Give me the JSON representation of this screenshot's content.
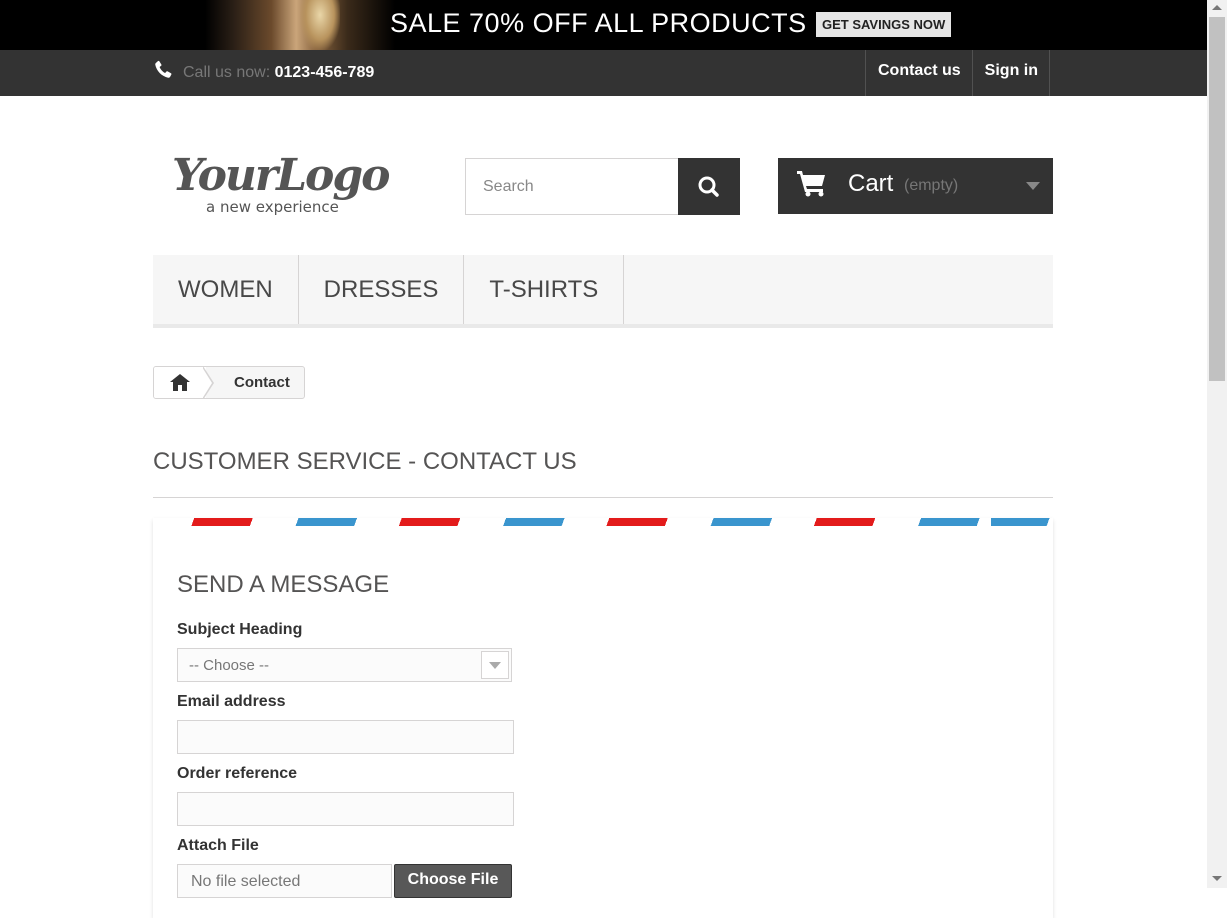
{
  "banner": {
    "headline": "SALE 70% OFF ALL PRODUCTS",
    "cta": "GET SAVINGS NOW"
  },
  "topbar": {
    "call_label": "Call us now:",
    "phone": "0123-456-789",
    "links": [
      "Contact us",
      "Sign in"
    ]
  },
  "header": {
    "logo_text": "YourLogo",
    "logo_tagline": "a new experience",
    "search_placeholder": "Search",
    "cart_label": "Cart",
    "cart_state": "(empty)"
  },
  "menu": {
    "items": [
      "WOMEN",
      "DRESSES",
      "T-SHIRTS"
    ]
  },
  "breadcrumb": {
    "current": "Contact"
  },
  "page": {
    "title": "CUSTOMER SERVICE - CONTACT US"
  },
  "form": {
    "heading": "SEND A MESSAGE",
    "subject_label": "Subject Heading",
    "subject_value": "-- Choose --",
    "email_label": "Email address",
    "email_value": "",
    "order_label": "Order reference",
    "order_value": "",
    "attach_label": "Attach File",
    "file_status": "No file selected",
    "choose_button": "Choose File"
  },
  "colors": {
    "dark": "#333333",
    "stripe_blue": "#3a95ce",
    "stripe_red": "#e31b1b"
  }
}
